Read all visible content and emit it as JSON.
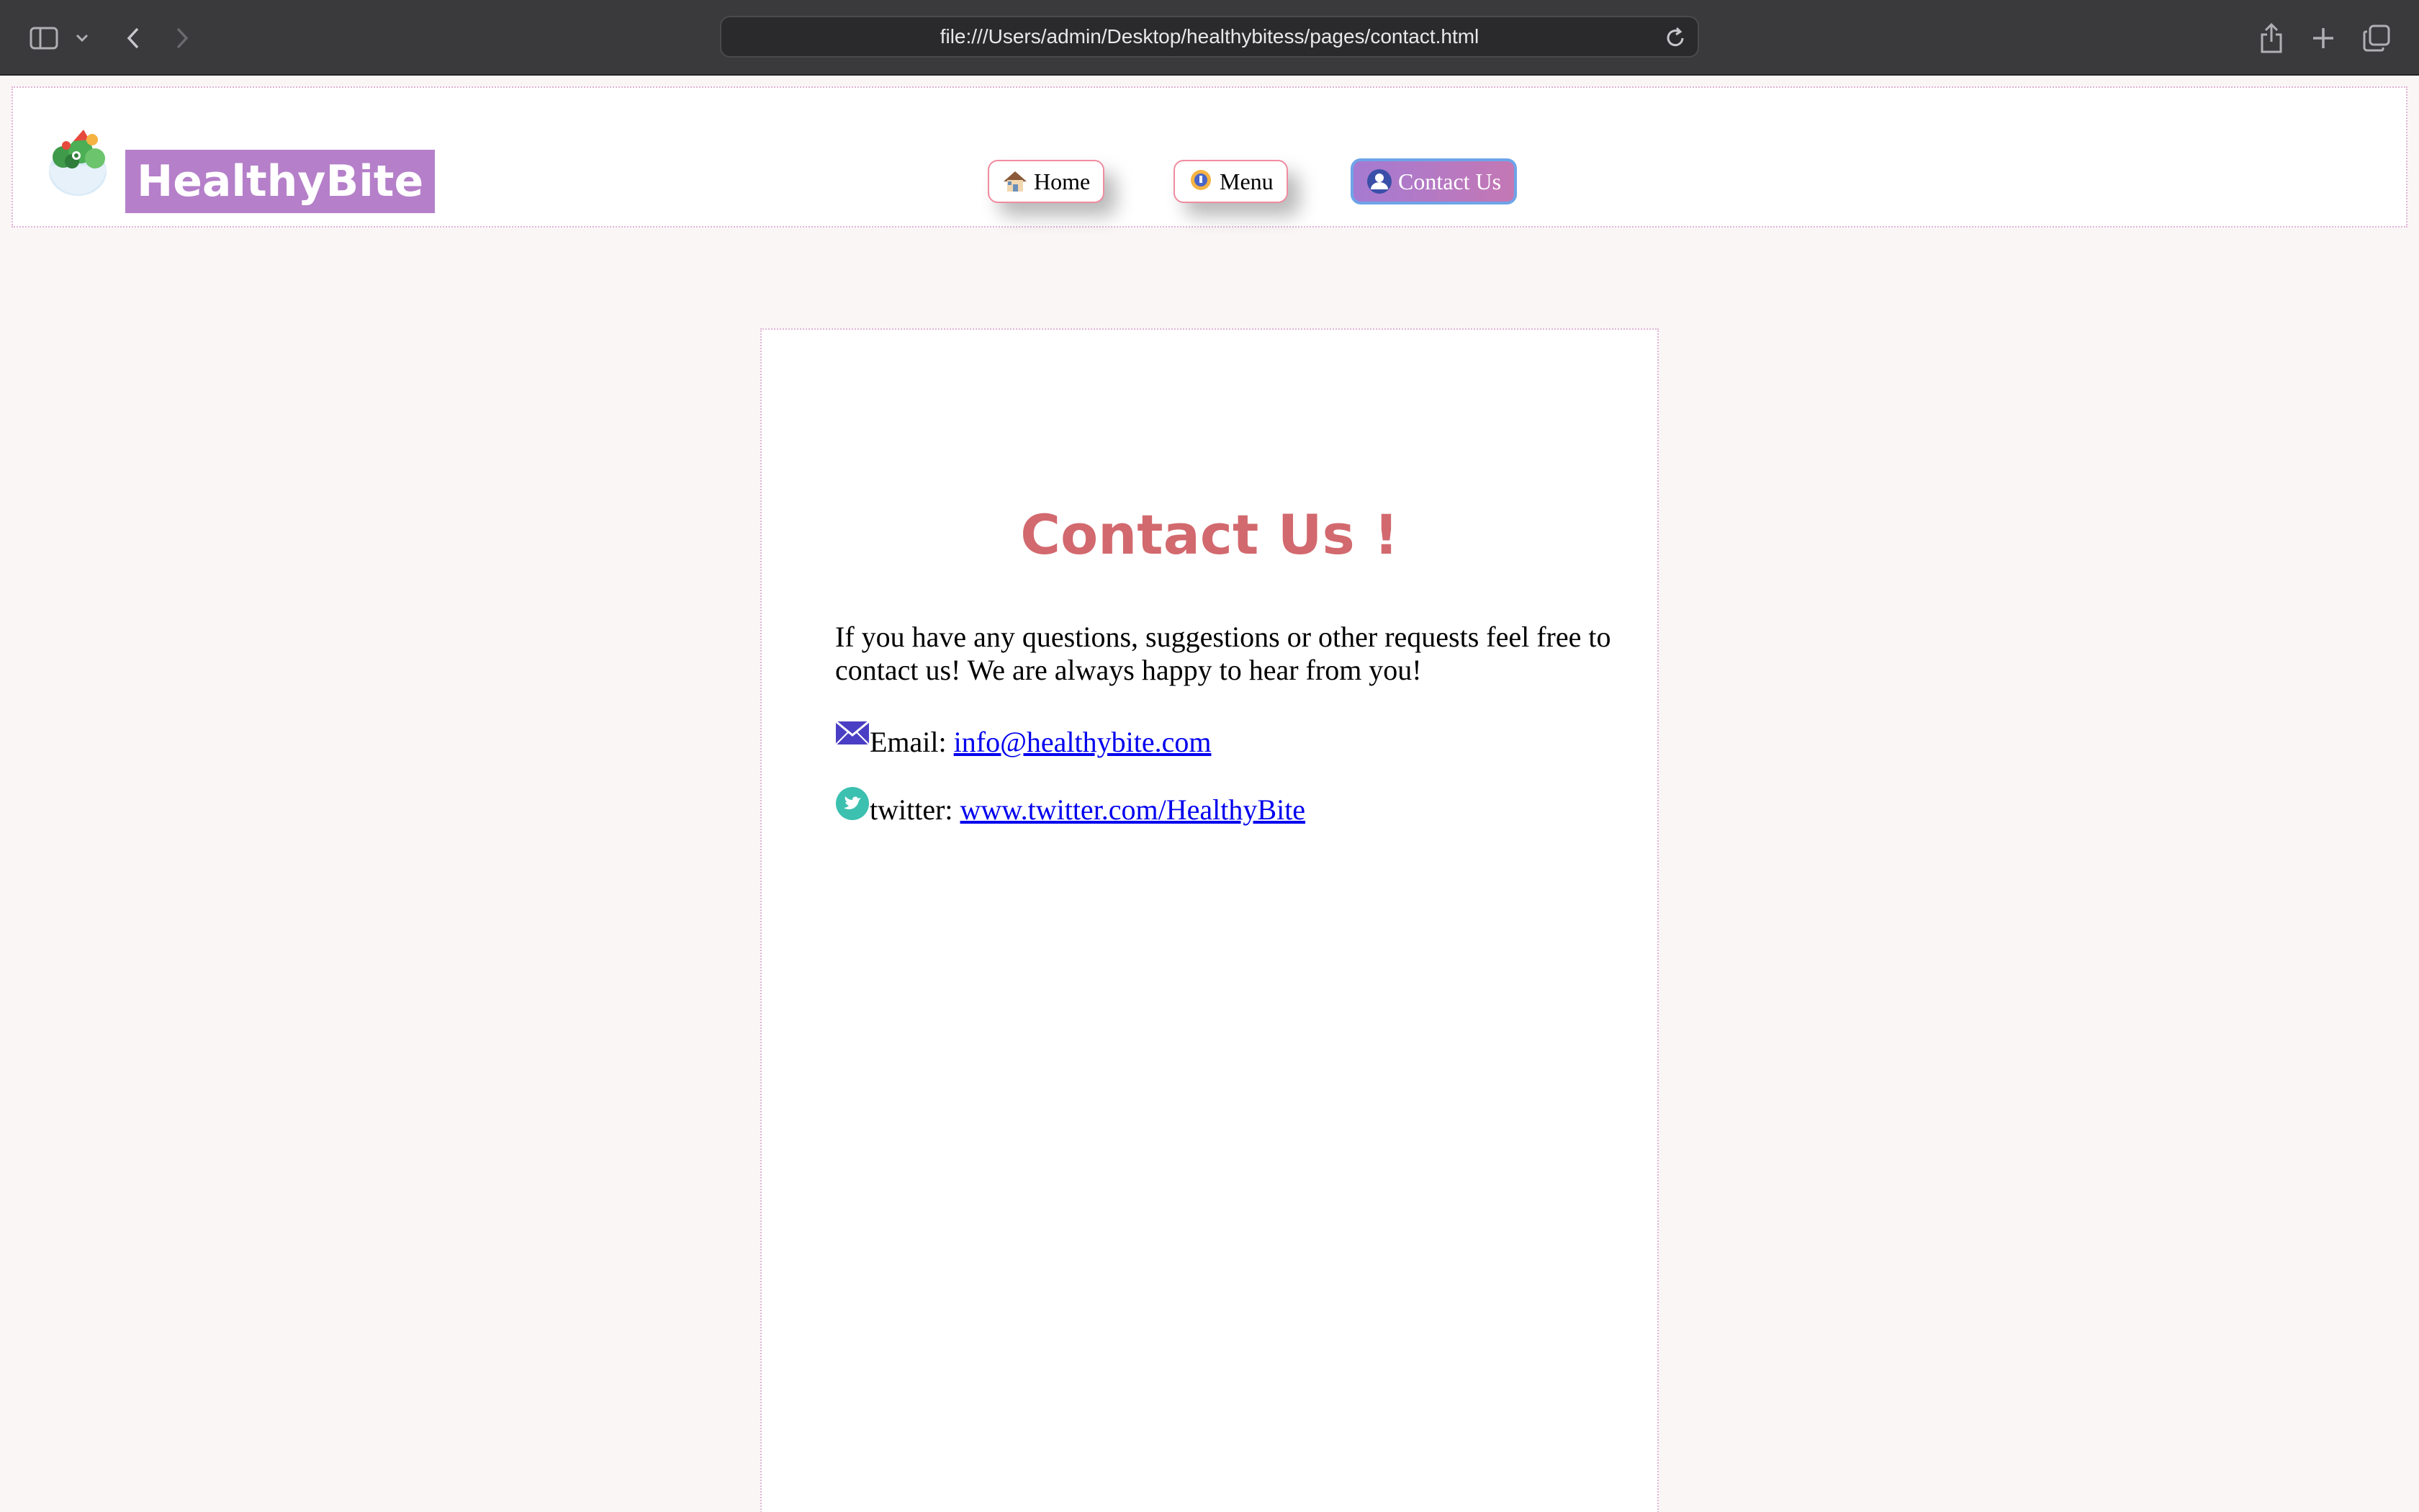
{
  "browser": {
    "url": "file:///Users/admin/Desktop/healthybitess/pages/contact.html",
    "icons": [
      "sidebar-icon",
      "chevron-down-icon",
      "back-icon",
      "forward-icon",
      "reload-icon",
      "share-icon",
      "new-tab-icon",
      "tabs-overview-icon"
    ]
  },
  "header": {
    "brand": "HealthyBite",
    "nav": [
      {
        "label": "Home",
        "icon": "house-icon"
      },
      {
        "label": "Menu",
        "icon": "menu-badge-icon"
      },
      {
        "label": "Contact Us",
        "icon": "user-icon",
        "active": true
      }
    ]
  },
  "main": {
    "title": "Contact Us !",
    "intro": "If you have any questions, suggestions or other requests feel free to contact us! We are always happy to hear from you!",
    "email_label": "Email:",
    "email_link": "info@healthybite.com",
    "twitter_label": "twitter:",
    "twitter_link": "www.twitter.com/HealthyBite"
  },
  "colors": {
    "title": "#d2696e",
    "brand_bg": "#b57fc9",
    "link": "#0000ee",
    "nav_border": "#f08ca0",
    "active_border": "#6ea4e8"
  }
}
